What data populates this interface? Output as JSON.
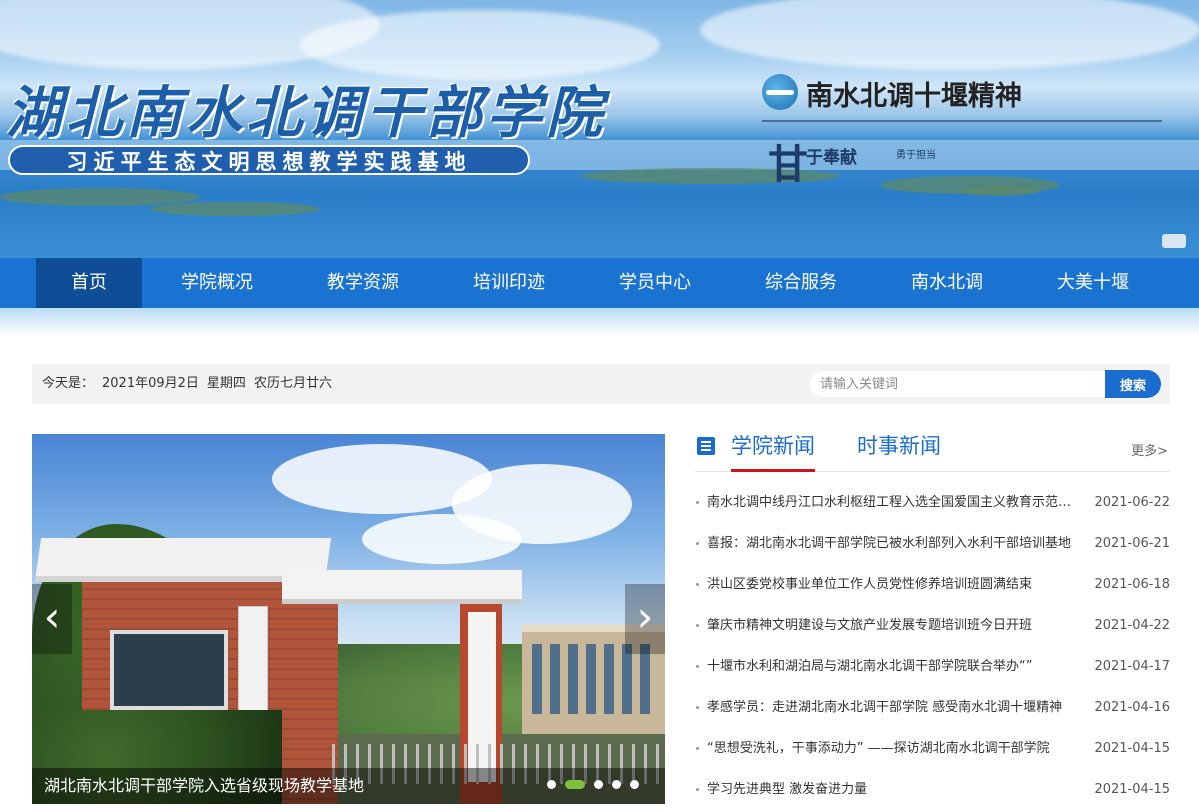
{
  "banner": {
    "title": "湖北南水北调干部学院",
    "slogan": "习近平生态文明思想教学实践基地",
    "spirit": "南水北调十堰精神",
    "motto_mark": "甘",
    "motto": "于奉献",
    "motto_small": "勇于担当"
  },
  "nav": {
    "items": [
      {
        "label": "首页",
        "active": true
      },
      {
        "label": "学院概况"
      },
      {
        "label": "教学资源"
      },
      {
        "label": "培训印迹"
      },
      {
        "label": "学员中心"
      },
      {
        "label": "综合服务"
      },
      {
        "label": "南水北调"
      },
      {
        "label": "大美十堰"
      }
    ]
  },
  "info": {
    "today_label": "今天是：",
    "date": "2021年09月2日",
    "weekday": "星期四",
    "lunar": "农历七月廿六"
  },
  "search": {
    "placeholder": "请输入关键词",
    "button": "搜索"
  },
  "slider": {
    "caption": "湖北南水北调干部学院入选省级现场教学基地",
    "prev_icon": "‹",
    "next_icon": "›",
    "dot_count": 5,
    "active_dot": 1
  },
  "news": {
    "tabs": [
      {
        "label": "学院新闻",
        "active": true
      },
      {
        "label": "时事新闻"
      }
    ],
    "more": "更多>",
    "items": [
      {
        "title": "南水北调中线丹江口水利枢纽工程入选全国爱国主义教育示范基地",
        "date": "2021-06-22"
      },
      {
        "title": "喜报：湖北南水北调干部学院已被水利部列入水利干部培训基地",
        "date": "2021-06-21"
      },
      {
        "title": "洪山区委党校事业单位工作人员党性修养培训班圆满结束",
        "date": "2021-06-18"
      },
      {
        "title": "肇庆市精神文明建设与文旅产业发展专题培训班今日开班",
        "date": "2021-04-22"
      },
      {
        "title": "十堰市水利和湖泊局与湖北南水北调干部学院联合举办“”",
        "date": "2021-04-17"
      },
      {
        "title": "孝感学员：走进湖北南水北调干部学院 感受南水北调十堰精神",
        "date": "2021-04-16"
      },
      {
        "title": "“思想受洗礼，干事添动力” ——探访湖北南水北调干部学院",
        "date": "2021-04-15"
      },
      {
        "title": "学习先进典型 激发奋进力量",
        "date": "2021-04-15"
      }
    ]
  }
}
